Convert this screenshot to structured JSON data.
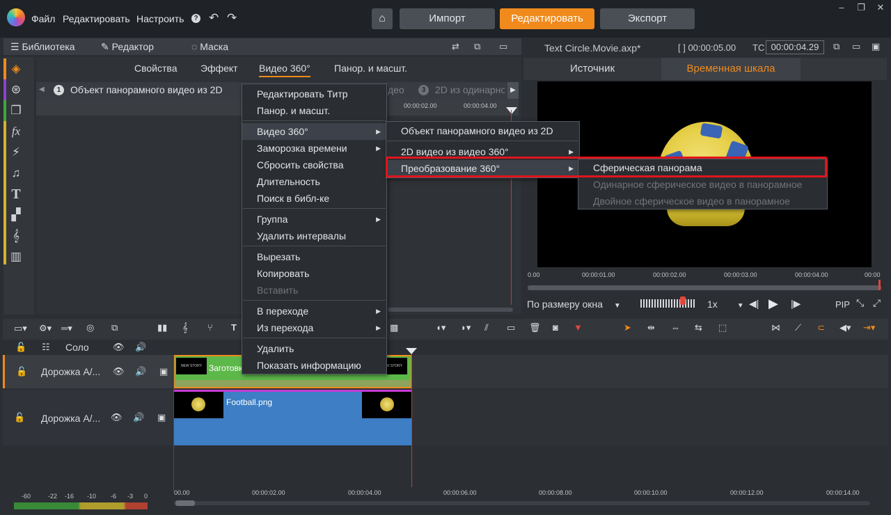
{
  "menubar": {
    "file": "Файл",
    "edit": "Редактировать",
    "settings": "Настроить",
    "help_icon": "question-icon"
  },
  "topbuttons": {
    "import": "Импорт",
    "edit": "Редактировать",
    "export": "Экспорт"
  },
  "left_tabs": {
    "library": "Библиотека",
    "editor": "Редактор",
    "mask": "Маска"
  },
  "editor_tabs": [
    "Свойства",
    "Эффект",
    "Видео 360°",
    "Панор. и масшт."
  ],
  "pano_steps": {
    "step1_num": "1",
    "step1": "Объект панорамного видео из 2D",
    "step2_partial": "део",
    "step3_num": "3",
    "step3": "2D из одинарно"
  },
  "editor_ruler": [
    "00:00:02.00",
    "00:00:04.00"
  ],
  "right_header": {
    "filename": "Text Circle.Movie.axp*",
    "duration": "[ ] 00:00:05.00",
    "tc_label": "TC",
    "tc_value": "00:00:04.29"
  },
  "source_tabs": {
    "source": "Источник",
    "timeline": "Временная шкала"
  },
  "preview_ruler": [
    "0.00",
    "00:00:01.00",
    "00:00:02.00",
    "00:00:03.00",
    "00:00:04.00",
    "00:00"
  ],
  "preview_controls": {
    "fit": "По размеру окна",
    "speed": "1x",
    "pip": "PIP"
  },
  "timeline_header": {
    "solo": "Соло"
  },
  "tracks": [
    {
      "name": "Дорожка А/...",
      "clip_label": "Заготовка",
      "thumb_text": "NEW STORY"
    },
    {
      "name": "Дорожка А/...",
      "clip_label": "Football.png"
    }
  ],
  "timeline_ruler": [
    "00.00",
    "00:00:02.00",
    "00:00:04.00",
    "00:00:06.00",
    "00:00:08.00",
    "00:00:10.00",
    "00:00:12.00",
    "00:00:14.00"
  ],
  "meter_labels": [
    "-60",
    "-22",
    "-16",
    "-10",
    "-6",
    "-3",
    "0"
  ],
  "context_menu": {
    "items": [
      "Редактировать Титр",
      "Панор. и масшт.",
      "Видео 360°",
      "Заморозка времени",
      "Сбросить свойства",
      "Длительность",
      "Поиск в библ-ке",
      "Группа",
      "Удалить интервалы",
      "Вырезать",
      "Копировать",
      "Вставить",
      "В переходе",
      "Из перехода",
      "Удалить",
      "Показать информацию"
    ]
  },
  "submenu_360": {
    "items": [
      "Объект панорамного видео из 2D",
      "2D видео из видео 360°",
      "Преобразование 360°"
    ]
  },
  "submenu_conv": {
    "items": [
      "Сферическая панорама",
      "Одинарное сферическое видео в панорамное",
      "Двойное сферическое видео в панорамное"
    ]
  },
  "colors": {
    "accent": "#f08a1c",
    "highlight_red": "#e0141c",
    "clip_blue": "#3d7ec4",
    "clip_green": "#5db84a"
  }
}
